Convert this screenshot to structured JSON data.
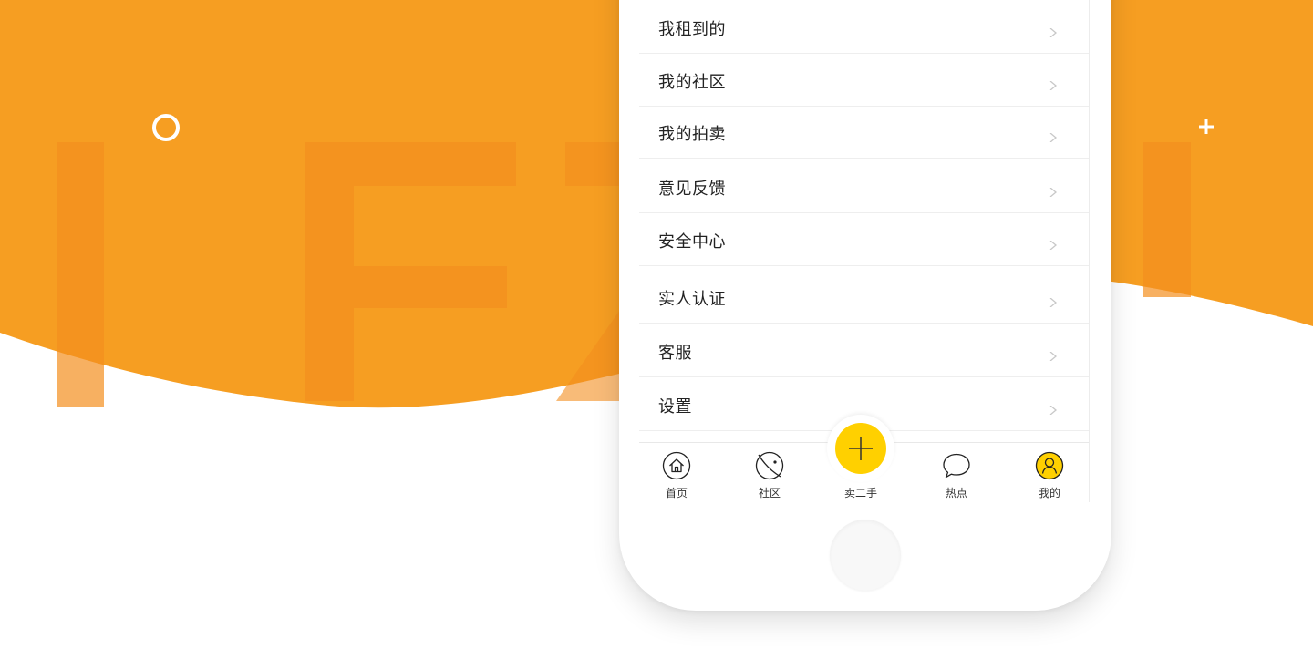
{
  "menu": {
    "items": [
      {
        "label": "我租到的"
      },
      {
        "label": "我的社区"
      },
      {
        "label": "我的拍卖"
      },
      {
        "label": "意见反馈"
      },
      {
        "label": "安全中心"
      },
      {
        "label": "实人认证"
      },
      {
        "label": "客服"
      },
      {
        "label": "设置"
      }
    ]
  },
  "tabbar": {
    "tabs": [
      {
        "label": "首页",
        "icon": "home-icon"
      },
      {
        "label": "社区",
        "icon": "planet-icon"
      },
      {
        "label": "卖二手",
        "icon": "plus-icon"
      },
      {
        "label": "热点",
        "icon": "chat-bubble-icon"
      },
      {
        "label": "我的",
        "icon": "user-icon"
      }
    ]
  },
  "colors": {
    "accent": "#ffd000",
    "background_orange": "#f69e22",
    "text": "#222222"
  }
}
